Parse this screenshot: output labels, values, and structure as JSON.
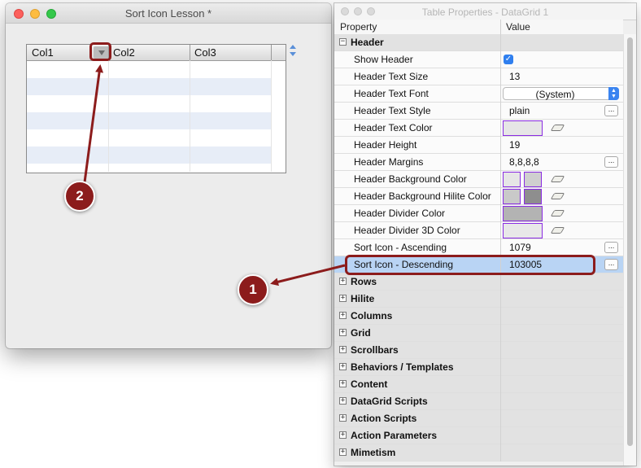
{
  "left_window": {
    "title": "Sort Icon Lesson *",
    "grid": {
      "columns": [
        "Col1",
        "Col2",
        "Col3"
      ]
    }
  },
  "right_window": {
    "title": "Table Properties - DataGrid 1",
    "columns": {
      "property": "Property",
      "value": "Value"
    },
    "header_group": {
      "label": "Header",
      "expander": "−",
      "rows": {
        "show_header": {
          "label": "Show Header",
          "checked": true
        },
        "text_size": {
          "label": "Header Text Size",
          "value": "13"
        },
        "text_font": {
          "label": "Header Text Font",
          "value": "(System)"
        },
        "text_style": {
          "label": "Header Text Style",
          "value": "plain"
        },
        "text_color": {
          "label": "Header Text Color"
        },
        "height": {
          "label": "Header Height",
          "value": "19"
        },
        "margins": {
          "label": "Header Margins",
          "value": "8,8,8,8"
        },
        "bg_color": {
          "label": "Header Background Color"
        },
        "bg_hilite": {
          "label": "Header Background Hilite Color"
        },
        "divider": {
          "label": "Header Divider Color"
        },
        "divider_3d": {
          "label": "Header Divider 3D Color"
        },
        "sort_asc": {
          "label": "Sort Icon - Ascending",
          "value": "1079"
        },
        "sort_desc": {
          "label": "Sort Icon - Descending",
          "value": "103005"
        }
      }
    },
    "collapsed_groups": [
      "Rows",
      "Hilite",
      "Columns",
      "Grid",
      "Scrollbars",
      "Behaviors / Templates",
      "Content",
      "DataGrid Scripts",
      "Action Scripts",
      "Action Parameters",
      "Mimetism"
    ],
    "expander_plus": "+",
    "ellipsis": "...",
    "checkmark": "✓"
  },
  "callouts": {
    "one": "1",
    "two": "2"
  },
  "colors": {
    "callout": "#8c1c1c",
    "selection": "#b9d4f4",
    "swatch_border": "#8a2be2",
    "swatch_light": "#e4e4e4",
    "swatch_mid": "#d0d0d0",
    "swatch_gray": "#b0b0b0",
    "swatch_dark": "#8a8a8a"
  },
  "icons": [
    "sort-descending-icon",
    "up-down-arrows-icon",
    "eraser-icon",
    "checkbox-icon",
    "popup-arrows-icon"
  ]
}
